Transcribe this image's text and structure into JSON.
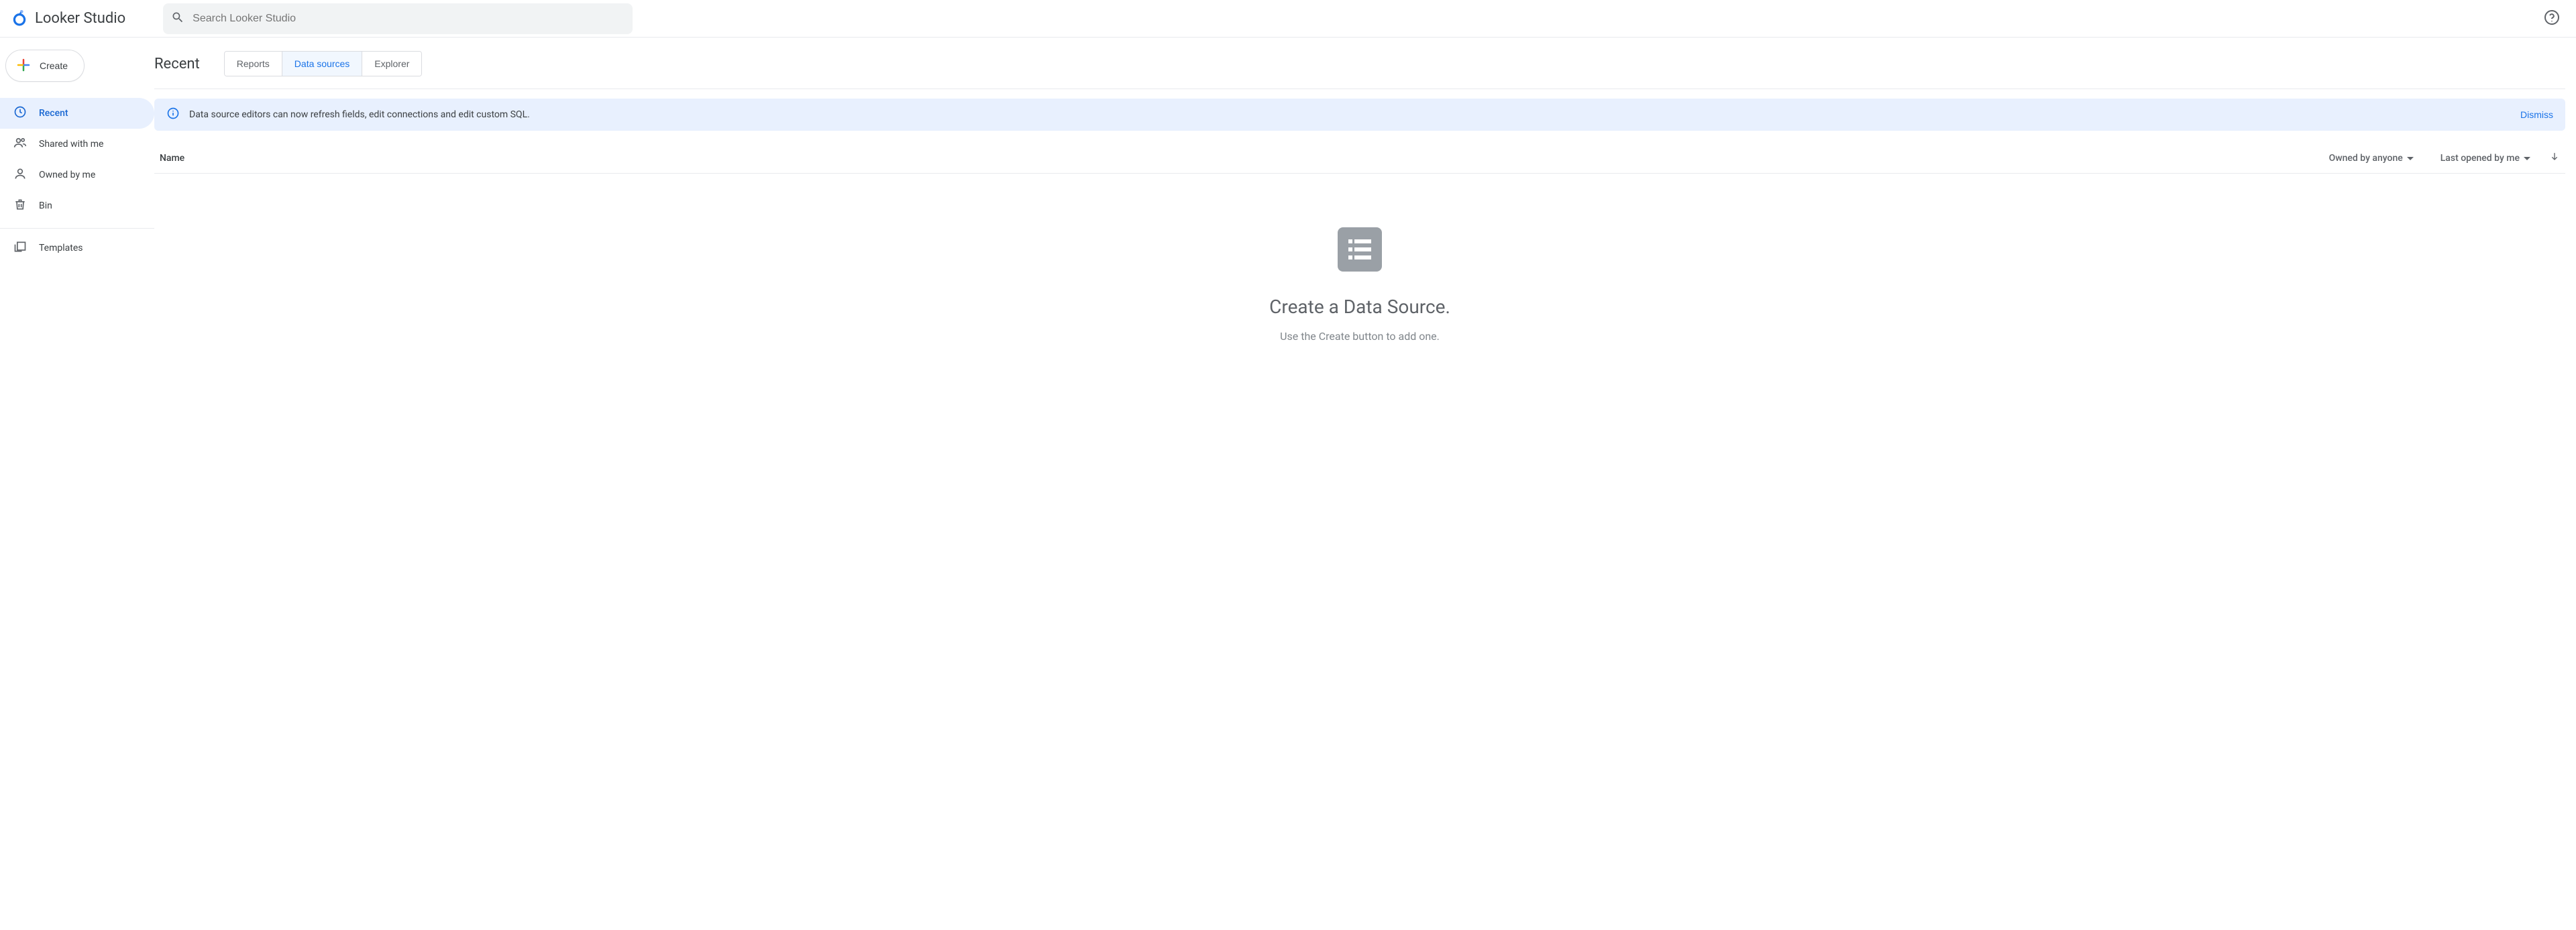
{
  "header": {
    "product_title": "Looker Studio",
    "search_placeholder": "Search Looker Studio"
  },
  "sidebar": {
    "create_label": "Create",
    "items": [
      {
        "label": "Recent",
        "active": true
      },
      {
        "label": "Shared with me",
        "active": false
      },
      {
        "label": "Owned by me",
        "active": false
      },
      {
        "label": "Bin",
        "active": false
      }
    ],
    "templates_label": "Templates"
  },
  "main": {
    "page_heading": "Recent",
    "tabs": [
      {
        "label": "Reports",
        "active": false
      },
      {
        "label": "Data sources",
        "active": true
      },
      {
        "label": "Explorer",
        "active": false
      }
    ],
    "banner": {
      "text": "Data source editors can now refresh fields, edit connections and edit custom SQL.",
      "dismiss_label": "Dismiss"
    },
    "list_header": {
      "name_label": "Name",
      "owned_label": "Owned by anyone",
      "lastopened_label": "Last opened by me"
    },
    "empty_state": {
      "title": "Create a Data Source.",
      "subtitle": "Use the Create button to add one."
    }
  }
}
